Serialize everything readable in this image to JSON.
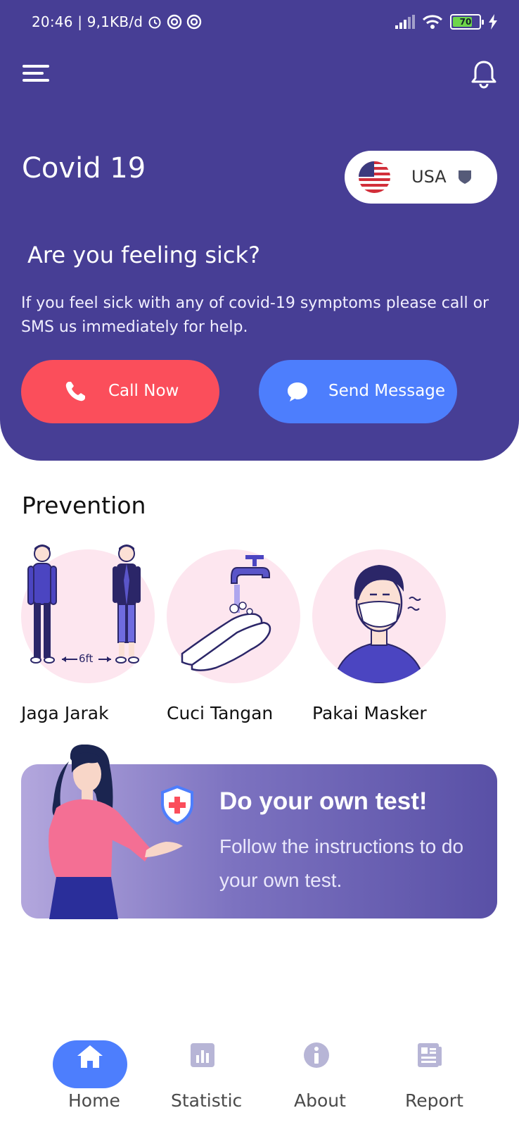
{
  "status": {
    "time_speed": "20:46 | 9,1KB/d",
    "battery": "70"
  },
  "header": {
    "app_title": "Covid 19",
    "country": {
      "label": "USA",
      "flag_icon": "us-flag-icon"
    },
    "question_title": "Are you feeling sick?",
    "question_desc": "If you feel sick with any of covid-19 symptoms please call or SMS us immediately for help.",
    "call_button": "Call Now",
    "message_button": "Send Message"
  },
  "prevention": {
    "title": "Prevention",
    "items": [
      {
        "label": "Jaga Jarak",
        "icon": "social-distance-illustration",
        "distance_text": "6ft"
      },
      {
        "label": "Cuci Tangan",
        "icon": "hand-washing-illustration"
      },
      {
        "label": "Pakai Masker",
        "icon": "face-mask-illustration"
      }
    ]
  },
  "test_card": {
    "title": "Do your own test!",
    "desc": "Follow the instructions to do your own test."
  },
  "nav": {
    "items": [
      {
        "label": "Home",
        "icon": "home-icon",
        "active": true
      },
      {
        "label": "Statistic",
        "icon": "statistic-icon"
      },
      {
        "label": "About",
        "icon": "info-icon"
      },
      {
        "label": "Report",
        "icon": "report-icon"
      }
    ]
  },
  "colors": {
    "header_bg": "#473e95",
    "call": "#fb4e5b",
    "message": "#4d7efd",
    "accent_pink": "#fde6ef"
  }
}
